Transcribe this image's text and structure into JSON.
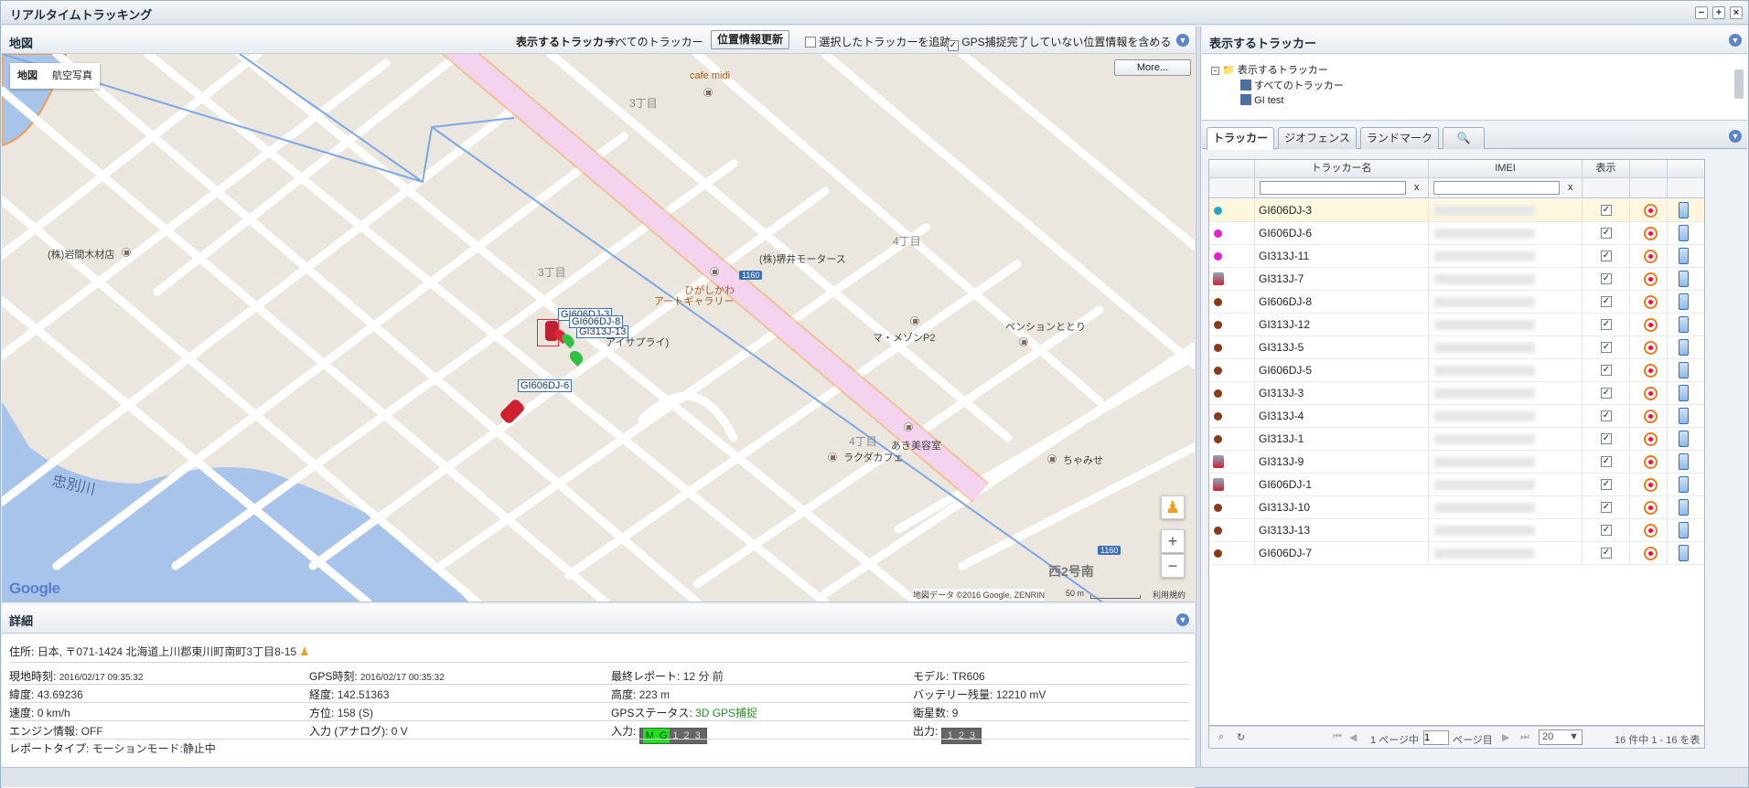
{
  "window": {
    "title": "リアルタイムトラッキング"
  },
  "map_panel": {
    "title": "地図",
    "trackers_label": "表示するトラッカー:",
    "trackers_value": "すべてのトラッカー",
    "refresh_button": "位置情報更新",
    "follow_label": "選択したトラッカーを追跡",
    "follow_checked": false,
    "include_label": "GPS捕捉完了していない位置情報を含める",
    "include_checked": true,
    "map_type_map": "地図",
    "map_type_satellite": "航空写真",
    "more_button": "More...",
    "attribution": "地図データ ©2016 Google, ZENRIN",
    "scale": "50 m",
    "terms": "利用規約",
    "google_logo": "Google",
    "labels": {
      "cafe": "cafe midi",
      "chome3a": "3丁目",
      "chome3b": "3丁目",
      "chome4a": "4丁目",
      "chome4b": "4丁目",
      "iwama": "(株)岩間木材店",
      "sakai": "(株)堺井モータース",
      "gallery1": "ひがしかわ",
      "gallery2": "アートギャラリー",
      "maison": "マ・メゾンP2",
      "pension": "ペンションととり",
      "aki": "あき美容室",
      "ragda": "ラクダカフェ",
      "chamise": "ちゃみせ",
      "river": "忠別川",
      "nishi": "西2号南",
      "route1": "1160",
      "route2": "1160",
      "supply": "アイサプライ)"
    },
    "markers": [
      {
        "label": "GI606DJ-3"
      },
      {
        "label": "GI313J-13"
      },
      {
        "label": "GI606DJ-8"
      },
      {
        "label": "GI606DJ-6"
      }
    ]
  },
  "details_panel": {
    "title": "詳細",
    "address_label": "住所:",
    "address": "日本, 〒071-1424 北海道上川郡東川町南町3丁目8-15",
    "rows": [
      [
        {
          "k": "現地時刻:",
          "v": "2016/02/17 09:35:32"
        },
        {
          "k": "GPS時刻:",
          "v": "2016/02/17 00:35:32"
        },
        {
          "k": "最終レポート:",
          "v": "12 分 前"
        },
        {
          "k": "モデル:",
          "v": "TR606"
        }
      ],
      [
        {
          "k": "緯度:",
          "v": "43.69236"
        },
        {
          "k": "経度:",
          "v": "142.51363"
        },
        {
          "k": "高度:",
          "v": "223 m"
        },
        {
          "k": "バッテリー残量:",
          "v": "12210 mV"
        }
      ],
      [
        {
          "k": "速度:",
          "v": "0 km/h"
        },
        {
          "k": "方位:",
          "v": "158 (S)"
        },
        {
          "k": "GPSステータス:",
          "v": "3D GPS捕捉"
        },
        {
          "k": "衛星数:",
          "v": "9"
        }
      ],
      [
        {
          "k": "エンジン情報:",
          "v": "OFF"
        },
        {
          "k": "入力 (アナログ):",
          "v": "0 V"
        },
        {
          "k": "入力:",
          "v": ""
        },
        {
          "k": "出力:",
          "v": ""
        }
      ]
    ],
    "report_label": "レポートタイプ:",
    "report_value": "モーションモード:静止中",
    "input_on": [
      "M",
      "G"
    ],
    "input_off": [
      "1",
      "2",
      "3"
    ],
    "output_off": [
      "1",
      "2",
      "3"
    ],
    "status_color": "#2a8a2a"
  },
  "right_panel": {
    "title": "表示するトラッカー",
    "tree": {
      "root": "表示するトラッカー",
      "child1": "すべてのトラッカー",
      "child2": "GI test"
    },
    "tabs": [
      "トラッカー",
      "ジオフェンス",
      "ランドマーク"
    ],
    "columns": {
      "name": "トラッカー名",
      "imei": "IMEI",
      "show": "表示"
    },
    "clear_x": "x",
    "rows": [
      {
        "name": "GI606DJ-3",
        "color": "#21a6c6",
        "checked": true
      },
      {
        "name": "GI606DJ-6",
        "color": "#e620d0",
        "checked": true
      },
      {
        "name": "GI313J-11",
        "color": "#e620d0",
        "checked": true
      },
      {
        "name": "GI313J-7",
        "color": "car",
        "checked": true
      },
      {
        "name": "GI606DJ-8",
        "color": "#8a3a16",
        "checked": true
      },
      {
        "name": "GI313J-12",
        "color": "#8a3a16",
        "checked": true
      },
      {
        "name": "GI313J-5",
        "color": "#8a3a16",
        "checked": true
      },
      {
        "name": "GI606DJ-5",
        "color": "#8a3a16",
        "checked": true
      },
      {
        "name": "GI313J-3",
        "color": "#8a3a16",
        "checked": true
      },
      {
        "name": "GI313J-4",
        "color": "#8a3a16",
        "checked": true
      },
      {
        "name": "GI313J-1",
        "color": "#8a3a16",
        "checked": true
      },
      {
        "name": "GI313J-9",
        "color": "car",
        "checked": true
      },
      {
        "name": "GI606DJ-1",
        "color": "car",
        "checked": true
      },
      {
        "name": "GI313J-10",
        "color": "#8a3a16",
        "checked": true
      },
      {
        "name": "GI313J-13",
        "color": "#8a3a16",
        "checked": true
      },
      {
        "name": "GI606DJ-7",
        "color": "#8a3a16",
        "checked": true
      }
    ],
    "pager": {
      "page_pre": "1 ページ中",
      "page_value": "1",
      "page_post": "ページ目",
      "page_size": "20",
      "summary": "16 件中 1 - 16 を表"
    }
  }
}
